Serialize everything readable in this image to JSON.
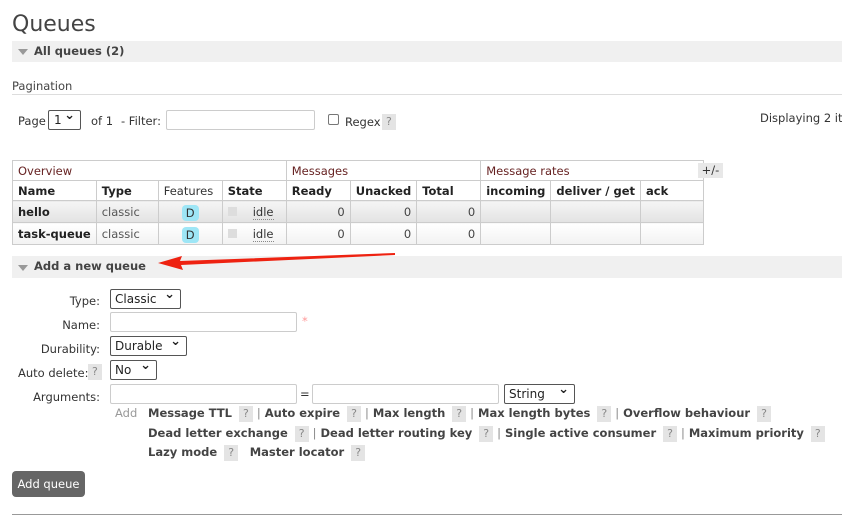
{
  "title": "Queues",
  "all_queues": "All queues (2)",
  "pagination": {
    "label": "Pagination",
    "page_label": "Page",
    "page_value": "1",
    "of": "of 1",
    "filter_label": "- Filter:",
    "filter_value": "",
    "regex_label": "Regex",
    "help": "?",
    "displaying": "Displaying 2 ite"
  },
  "table": {
    "groups": [
      "Overview",
      "Messages",
      "Message rates"
    ],
    "toggle": "+/-",
    "columns": [
      "Name",
      "Type",
      "Features",
      "State",
      "Ready",
      "Unacked",
      "Total",
      "incoming",
      "deliver / get",
      "ack"
    ],
    "rows": [
      {
        "name": "hello",
        "type": "classic",
        "feature": "D",
        "state": "idle",
        "ready": "0",
        "unacked": "0",
        "total": "0"
      },
      {
        "name": "task-queue",
        "type": "classic",
        "feature": "D",
        "state": "idle",
        "ready": "0",
        "unacked": "0",
        "total": "0"
      }
    ]
  },
  "add_section": "Add a new queue",
  "form": {
    "type_label": "Type:",
    "type_value": "Classic",
    "name_label": "Name:",
    "required": "*",
    "durability_label": "Durability:",
    "durability_value": "Durable",
    "auto_delete_label": "Auto delete:",
    "auto_delete_value": "No",
    "arguments_label": "Arguments:",
    "equals": "=",
    "arg_type": "String",
    "add": "Add",
    "help": "?",
    "arg_links": [
      [
        "Message TTL",
        "Auto expire",
        "Max length",
        "Max length bytes",
        "Overflow behaviour"
      ],
      [
        "Dead letter exchange",
        "Dead letter routing key",
        "Single active consumer",
        "Maximum priority"
      ],
      [
        "Lazy mode",
        "Master locator"
      ]
    ],
    "submit": "Add queue"
  },
  "colors": {
    "arrow": "#ee2211",
    "feature_badge": "#9ee6f6",
    "button": "#666666"
  }
}
